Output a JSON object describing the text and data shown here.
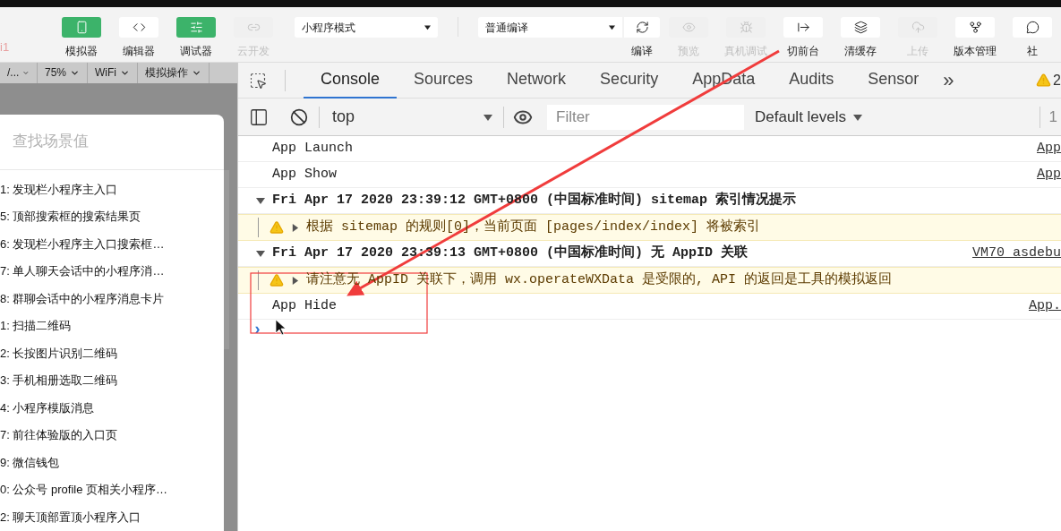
{
  "brand_fragment": "i1",
  "toolbar": {
    "left_tools": [
      {
        "label": "模拟器",
        "active": true,
        "disabled": false
      },
      {
        "label": "编辑器",
        "active": false,
        "disabled": false
      },
      {
        "label": "调试器",
        "active": true,
        "disabled": false
      },
      {
        "label": "云开发",
        "active": false,
        "disabled": true
      }
    ],
    "mode_select": {
      "value": "小程序模式"
    },
    "compile_select": {
      "value": "普通编译"
    },
    "right_tools": [
      {
        "label": "编译",
        "disabled": false
      },
      {
        "label": "预览",
        "disabled": true
      },
      {
        "label": "真机调试",
        "disabled": true
      },
      {
        "label": "切前台",
        "disabled": false
      },
      {
        "label": "清缓存",
        "disabled": false
      },
      {
        "label": "上传",
        "disabled": true
      },
      {
        "label": "版本管理",
        "disabled": false
      },
      {
        "label": "社",
        "disabled": false
      }
    ]
  },
  "simulator_bar": [
    "/...",
    "75%",
    "WiFi",
    "模拟操作"
  ],
  "scene_popup": {
    "placeholder": "查找场景值",
    "items": [
      "1: 发现栏小程序主入口",
      "5: 顶部搜索框的搜索结果页",
      "6: 发现栏小程序主入口搜索框…",
      "7: 单人聊天会话中的小程序消…",
      "8: 群聊会话中的小程序消息卡片",
      "1: 扫描二维码",
      "2: 长按图片识别二维码",
      "3: 手机相册选取二维码",
      "4: 小程序模版消息",
      "7: 前往体验版的入口页",
      "9: 微信钱包",
      "0: 公众号 profile 页相关小程序…",
      "2: 聊天顶部置顶小程序入口"
    ]
  },
  "devtools": {
    "tabs": [
      {
        "label": "Console",
        "selected": true
      },
      {
        "label": "Sources",
        "selected": false
      },
      {
        "label": "Network",
        "selected": false
      },
      {
        "label": "Security",
        "selected": false
      },
      {
        "label": "AppData",
        "selected": false
      },
      {
        "label": "Audits",
        "selected": false
      },
      {
        "label": "Sensor",
        "selected": false
      }
    ],
    "more": "»",
    "warning_count": "2",
    "context_select": {
      "value": "top"
    },
    "filter": {
      "placeholder": "Filter"
    },
    "levels": "Default levels",
    "counter_fragment": "1"
  },
  "console": [
    {
      "kind": "log",
      "text": "App Launch",
      "source": "App"
    },
    {
      "kind": "log",
      "text": "App Show",
      "source": "App"
    },
    {
      "kind": "group",
      "expanded": true,
      "text": "Fri Apr 17 2020 23:39:12 GMT+0800 (中国标准时间) sitemap 索引情况提示"
    },
    {
      "kind": "warning",
      "expanded": false,
      "text": "根据 sitemap 的规则[0]，当前页面 [pages/index/index] 将被索引"
    },
    {
      "kind": "group",
      "expanded": true,
      "text": "Fri Apr 17 2020 23:39:13 GMT+0800 (中国标准时间) 无 AppID 关联",
      "source": "VM70 asdebu"
    },
    {
      "kind": "warning",
      "expanded": false,
      "text": "请注意无 AppID 关联下，调用 wx.operateWXData 是受限的, API 的返回是工具的模拟返回"
    },
    {
      "kind": "log",
      "text": "App Hide",
      "source": "App."
    }
  ],
  "prompt": "›"
}
